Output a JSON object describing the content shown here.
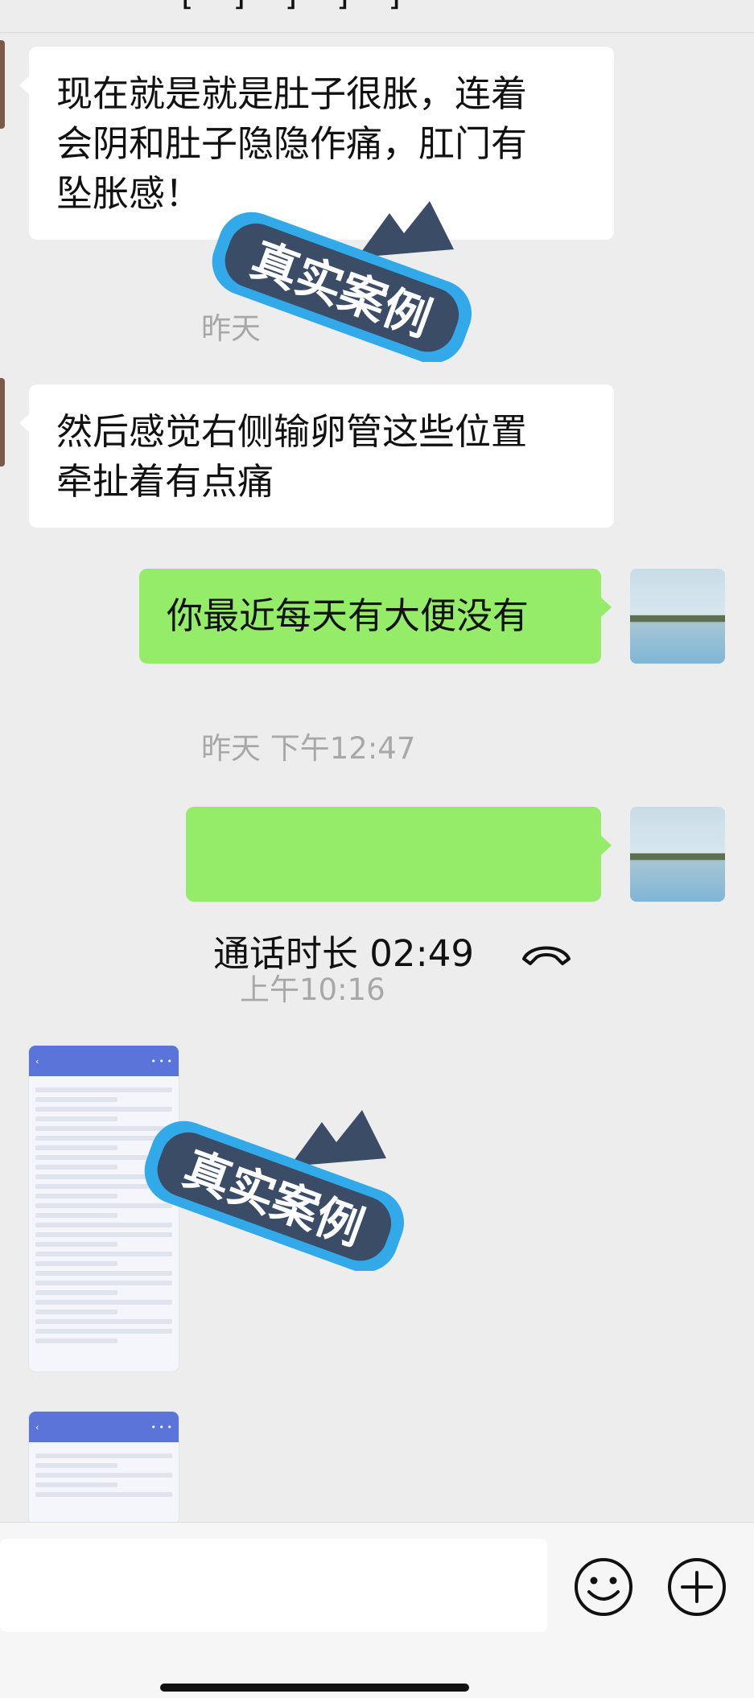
{
  "messages": [
    {
      "side": "left",
      "text": "现在就是就是肚子很胀，连着\n会阴和肚子隐隐作痛，肛门有\n坠胀感！"
    },
    {
      "side": "left",
      "text": "然后感觉右侧输卵管这些位置\n牵扯着有点痛"
    },
    {
      "side": "right",
      "text": "你最近每天有大便没有"
    }
  ],
  "timestamps": {
    "partial_yesterday": "昨天",
    "yesterday_time": "昨天 下午12:47",
    "morning_time": "上午10:16"
  },
  "call": {
    "text": "通话时长 02:49",
    "icon": "phone-hangup-icon"
  },
  "watermark": {
    "text": "真实案例"
  },
  "input_bar": {
    "emoji_icon": "emoji-icon",
    "plus_icon": "plus-icon"
  },
  "colors": {
    "my_bubble": "#95ec69",
    "their_bubble": "#ffffff",
    "background": "#ededed",
    "watermark_blue": "#32a9e8",
    "watermark_dark": "#3b4c66"
  }
}
